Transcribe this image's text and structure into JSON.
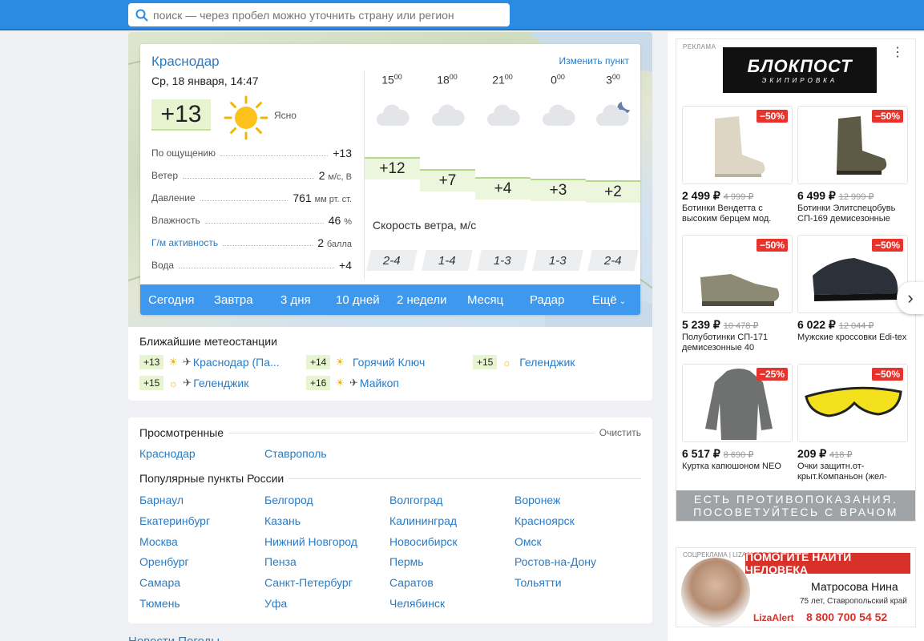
{
  "search": {
    "placeholder": "поиск — через пробел можно уточнить страну или регион"
  },
  "weather": {
    "city": "Краснодар",
    "change_label": "Изменить пункт",
    "datetime": "Ср, 18 января, 14:47",
    "temp_now": "+13",
    "condition": "Ясно",
    "params": [
      {
        "label": "По ощущению",
        "value": "+13",
        "unit": ""
      },
      {
        "label": "Ветер",
        "value": "2",
        "unit": "м/с, В"
      },
      {
        "label": "Давление",
        "value": "761",
        "unit": "мм рт. ст."
      },
      {
        "label": "Влажность",
        "value": "46",
        "unit": "%"
      },
      {
        "label": "Г/м активность",
        "value": "2",
        "unit": "балла"
      },
      {
        "label": "Вода",
        "value": "+4",
        "unit": ""
      }
    ],
    "hours": [
      {
        "h": "15",
        "m": "00",
        "temp": "+12",
        "wind": "2-4",
        "icon": "cloudy-icon"
      },
      {
        "h": "18",
        "m": "00",
        "temp": "+7",
        "wind": "1-4",
        "icon": "cloudy-icon"
      },
      {
        "h": "21",
        "m": "00",
        "temp": "+4",
        "wind": "1-3",
        "icon": "cloudy-icon"
      },
      {
        "h": "0",
        "m": "00",
        "temp": "+3",
        "wind": "1-3",
        "icon": "cloudy-icon"
      },
      {
        "h": "3",
        "m": "00",
        "temp": "+2",
        "wind": "2-4",
        "icon": "cloudy-night-icon"
      }
    ],
    "wind_title": "Скорость ветра, м/с",
    "tabs": [
      "Сегодня",
      "Завтра",
      "3 дня",
      "10 дней",
      "2 недели",
      "Месяц",
      "Радар",
      "Ещё"
    ]
  },
  "stations": {
    "title": "Ближайшие метеостанции",
    "items": [
      {
        "temp": "+13",
        "name": "Краснодар (Па...",
        "plane": true,
        "icon": "sun-icon"
      },
      {
        "temp": "+14",
        "name": "Горячий Ключ",
        "plane": false,
        "icon": "sun-icon"
      },
      {
        "temp": "+15",
        "name": "Геленджик",
        "plane": false,
        "icon": "sun-haze-icon"
      },
      {
        "temp": "+15",
        "name": "Геленджик",
        "plane": true,
        "icon": "sun-haze-icon"
      },
      {
        "temp": "+16",
        "name": "Майкоп",
        "plane": true,
        "icon": "sun-icon"
      }
    ]
  },
  "viewed": {
    "title": "Просмотренные",
    "clear_label": "Очистить",
    "items": [
      "Краснодар",
      "Ставрополь"
    ],
    "popular_title": "Популярные пункты России",
    "popular": [
      [
        "Барнаул",
        "Белгород",
        "Волгоград",
        "Воронеж"
      ],
      [
        "Екатеринбург",
        "Казань",
        "Калининград",
        "Красноярск"
      ],
      [
        "Москва",
        "Нижний Новгород",
        "Новосибирск",
        "Омск"
      ],
      [
        "Оренбург",
        "Пенза",
        "Пермь",
        "Ростов-на-Дону"
      ],
      [
        "Самара",
        "Санкт-Петербург",
        "Саратов",
        "Тольятти"
      ],
      [
        "Тюмень",
        "Уфа",
        "Челябинск",
        ""
      ]
    ]
  },
  "bottom_link": "Новости Погоды",
  "ad": {
    "label": "РЕКЛАМА",
    "brand": "БЛОКПОСТ",
    "brand_sub": "ЭКИПИРОВКА",
    "warning": "ЕСТЬ ПРОТИВОПОКАЗАНИЯ. ПОСОВЕТУЙТЕСЬ С ВРАЧОМ",
    "products": [
      {
        "discount": "−50%",
        "price": "2 499 ₽",
        "old": "4 999 ₽",
        "name": "Ботинки Вендетта с высоким берцем мод.",
        "icon": "boot-icon"
      },
      {
        "discount": "−50%",
        "price": "6 499 ₽",
        "old": "12 999 ₽",
        "name": "Ботинки Элитспецобувь СП-169 демисезонные",
        "icon": "boot-icon"
      },
      {
        "discount": "−50%",
        "price": "5 239 ₽",
        "old": "10 478 ₽",
        "name": "Полуботинки СП-171 демисезонные 40",
        "icon": "shoe-icon"
      },
      {
        "discount": "−50%",
        "price": "6 022 ₽",
        "old": "12 044 ₽",
        "name": "Мужские кроссовки Edi-tex",
        "icon": "sneaker-icon"
      },
      {
        "discount": "−25%",
        "price": "6 517 ₽",
        "old": "8 690 ₽",
        "name": "Куртка капюшоном NEO",
        "icon": "jacket-icon"
      },
      {
        "discount": "−50%",
        "price": "209 ₽",
        "old": "418 ₽",
        "name": "Очки защитн.от-крыт.Компаньон (жел-",
        "icon": "glasses-icon"
      }
    ]
  },
  "social_ad": {
    "label": "СОЦРЕКЛАМА | LIZAALERT.ORG",
    "title": "ПОМОГИТЕ НАЙТИ ЧЕЛОВЕКА",
    "name": "Матросова Нина",
    "info": "75 лет, Ставропольский край",
    "brand": "LizaAlert",
    "phone": "8 800 700 54 52"
  }
}
